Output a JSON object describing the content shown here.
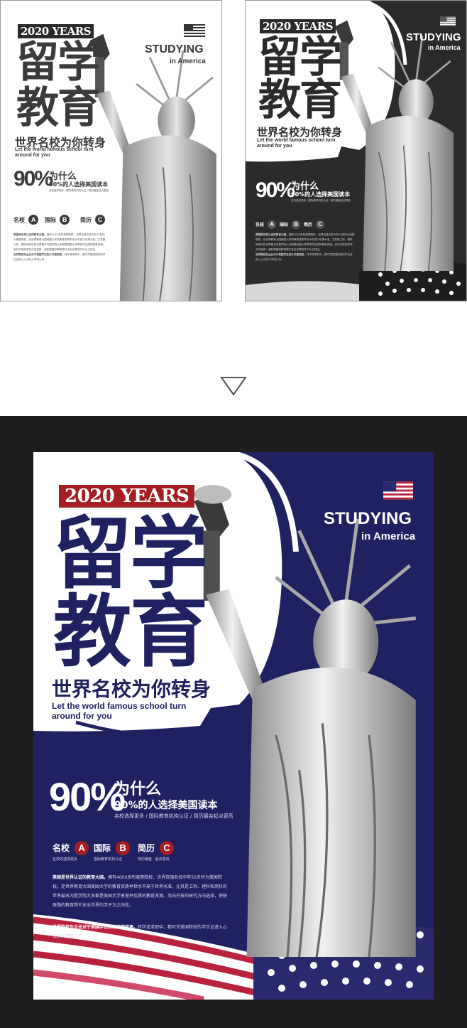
{
  "colors": {
    "navy": "#1f2160",
    "red": "#a51e22",
    "dark_bg": "#1e1e1e",
    "gray_poster": "#2b2b2b"
  },
  "poster": {
    "badge": "2020 YEARS",
    "title_line1": "留学",
    "title_line2": "教育",
    "studying": "STUDYING",
    "in_america": "in America",
    "slogan": "世界名校为你转身",
    "english_line1": "Let the world famous school turn",
    "english_line2": "around for you",
    "percent": "90%",
    "why": "为什么",
    "reason": "90%的人选择美国读本",
    "reason_sub": "名校选择更多 / 国际教育机构认证 / 简历镀金起点更高",
    "features": [
      {
        "label": "名校",
        "letter": "A",
        "sub": "名校的选择更多"
      },
      {
        "label": "国际",
        "letter": "B",
        "sub": "国际教育机构认证"
      },
      {
        "label": "简历",
        "letter": "C",
        "sub": "简历镀金 · 起点更高"
      }
    ],
    "para1_lead": "美国是世界认证的教育大国。",
    "para1": "拥有4000多所高等院校，世界百强名校中有50多所为美国院校。足世界教育大国美国大学的教育资质举世水平高于世界水准，尤其是工科、理科和商科的世界最名内是学院大多都是美国大学享誉并优质的教育资源。尚向开放的研究方向选择，使职原路的教育帮忙安全世界的学子为之向往。",
    "para2_lead": "世界院校及企业对于美国学位的认可度较高。",
    "para2": "转学或求职中，都可凭美国院校的学位证进入心仪的大学或公司。"
  },
  "arrow_icon": "down-triangle-icon"
}
